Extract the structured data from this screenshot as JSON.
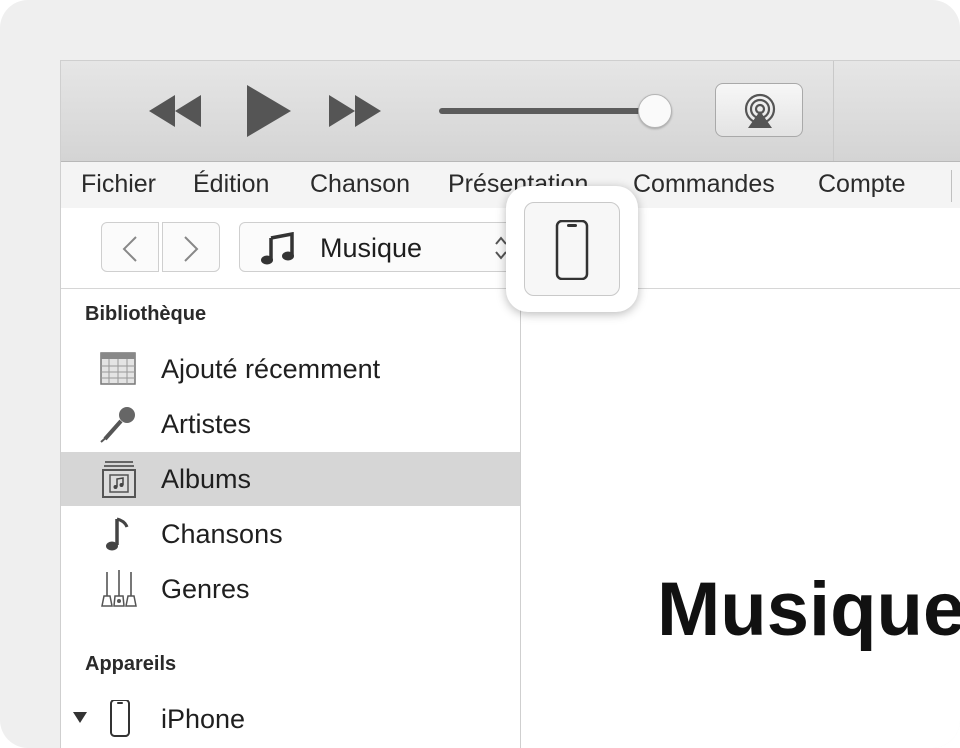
{
  "transport": {
    "rewind_icon": "rewind-icon",
    "play_icon": "play-icon",
    "fast_forward_icon": "fast-forward-icon",
    "volume_level": 0.95,
    "airplay_icon": "airplay-icon"
  },
  "menu": {
    "items": [
      {
        "label": "Fichier"
      },
      {
        "label": "Édition"
      },
      {
        "label": "Chanson"
      },
      {
        "label": "Présentation"
      },
      {
        "label": "Commandes"
      },
      {
        "label": "Compte"
      }
    ]
  },
  "nav": {
    "back_icon": "chevron-left-icon",
    "forward_icon": "chevron-right-icon",
    "media_type": "Musique",
    "media_icon": "music-note-icon",
    "device_icon": "iphone-icon"
  },
  "sidebar": {
    "library_title": "Bibliothèque",
    "items": [
      {
        "label": "Ajouté récemment",
        "icon": "calendar-grid-icon",
        "selected": false
      },
      {
        "label": "Artistes",
        "icon": "microphone-icon",
        "selected": false
      },
      {
        "label": "Albums",
        "icon": "album-stack-icon",
        "selected": true
      },
      {
        "label": "Chansons",
        "icon": "music-note-icon",
        "selected": false
      },
      {
        "label": "Genres",
        "icon": "guitars-icon",
        "selected": false
      }
    ],
    "devices_title": "Appareils",
    "devices": [
      {
        "label": "iPhone",
        "icon": "iphone-icon",
        "expanded": true
      }
    ]
  },
  "main": {
    "title": "Musique"
  }
}
